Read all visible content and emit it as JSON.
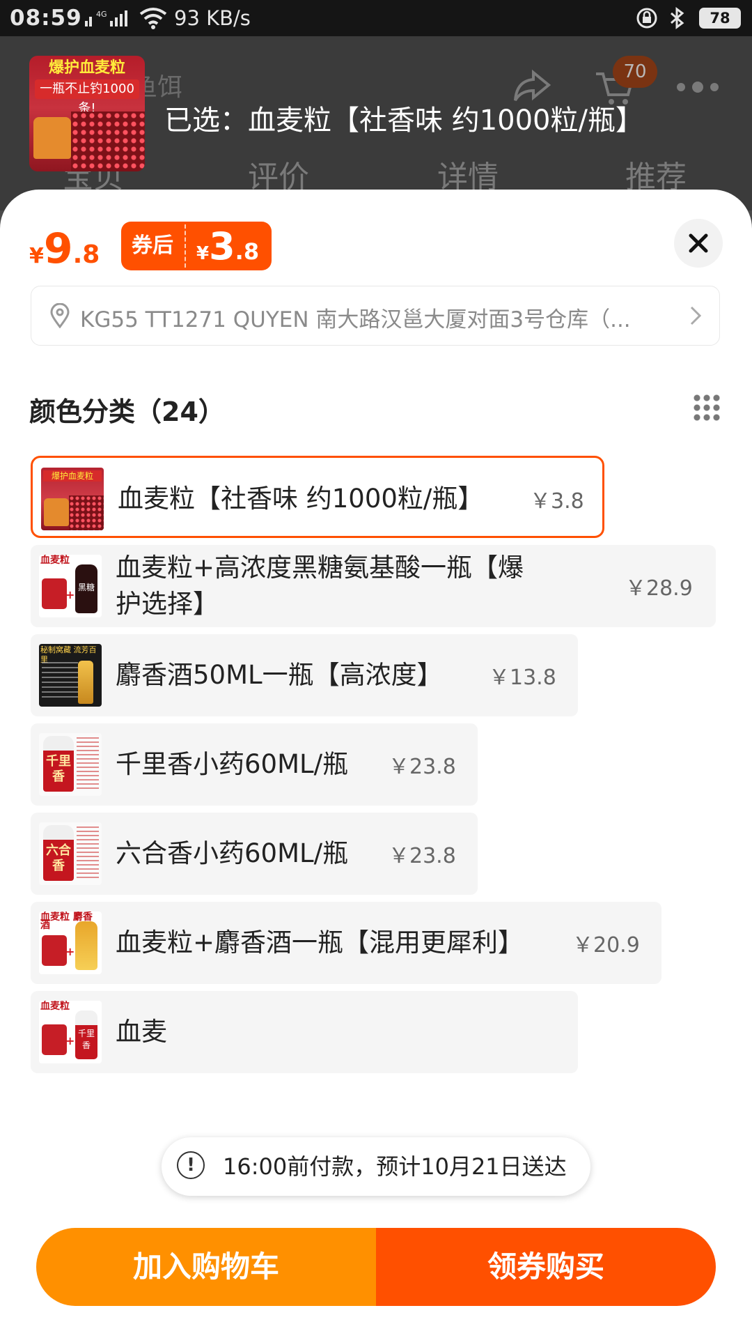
{
  "status_bar": {
    "time": "08:59",
    "network_speed": "93 KB/s",
    "signal_label": "4G",
    "battery": "78"
  },
  "background_page": {
    "search_text": "鱼饵",
    "cart_count": "70",
    "tabs": [
      "宝贝",
      "评价",
      "详情",
      "推荐"
    ],
    "thumb_title": "爆护血麦粒",
    "thumb_subtitle": "一瓶不止钓1000条!"
  },
  "sheet": {
    "selected_label": "已选：血麦粒【社香味 约1000粒/瓶】",
    "price": {
      "currency": "¥",
      "integer": "9",
      "decimal": ".8"
    },
    "coupon": {
      "label": "券后",
      "currency": "¥",
      "integer": "3",
      "decimal": ".8"
    },
    "address": "KG55 TT1271 QUYEN 南大路汉邕大厦对面3号仓库（...",
    "section_title": "颜色分类（24）",
    "options": [
      {
        "name": "血麦粒【社香味 约1000粒/瓶】",
        "price": "￥3.8",
        "selected": true,
        "thumb_text": "爆护血麦粒"
      },
      {
        "name": "血麦粒+高浓度黑糖氨基酸一瓶【爆护选择】",
        "price": "￥28.9",
        "selected": false,
        "thumb_text": "血麦粒",
        "thumb_bottle": "黑糖"
      },
      {
        "name": "麝香酒50ML一瓶【高浓度】",
        "price": "￥13.8",
        "selected": false,
        "thumb_text": "秘制窝藏 流芳百里"
      },
      {
        "name": "千里香小药60ML/瓶",
        "price": "￥23.8",
        "selected": false,
        "thumb_bottle": "千里香"
      },
      {
        "name": "六合香小药60ML/瓶",
        "price": "￥23.8",
        "selected": false,
        "thumb_bottle": "六合香"
      },
      {
        "name": "血麦粒+麝香酒一瓶【混用更犀利】",
        "price": "￥20.9",
        "selected": false,
        "thumb_text": "血麦粒 麝香酒"
      },
      {
        "name": "血麦",
        "price": "",
        "selected": false,
        "thumb_text": "血麦粒",
        "thumb_bottle": "千里香"
      }
    ],
    "toast": "16:00前付款，预计10月21日送达",
    "add_to_cart": "加入购物车",
    "buy_with_coupon": "领券购买"
  },
  "colors": {
    "accent": "#ff5000",
    "cart_button": "#ff9000"
  },
  "icons": [
    "search-icon",
    "share-icon",
    "cart-icon",
    "more-icon",
    "close-icon",
    "location-pin-icon",
    "chevron-right-icon",
    "grid-view-icon",
    "exclamation-icon"
  ]
}
